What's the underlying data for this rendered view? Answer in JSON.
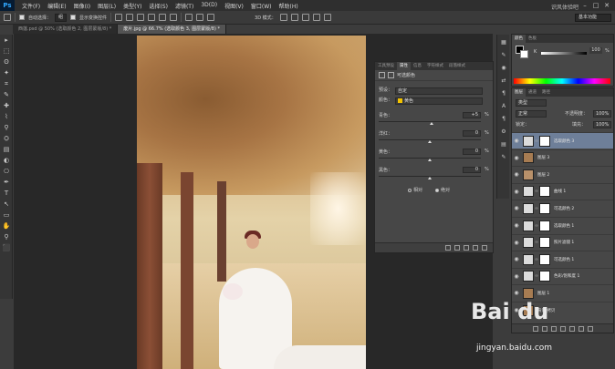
{
  "app": {
    "logo": "Ps",
    "title": "识风体验吧"
  },
  "menu": [
    "文件(F)",
    "编辑(E)",
    "图像(I)",
    "图层(L)",
    "类型(Y)",
    "选择(S)",
    "滤镜(T)",
    "3D(D)",
    "视图(V)",
    "窗口(W)",
    "帮助(H)"
  ],
  "options": {
    "auto_select_label": "自动选择：",
    "auto_select_value": "组",
    "show_transform_label": "显示变换控件",
    "mode_label": "3D 模式：",
    "workspace": "基本功能"
  },
  "tabs": [
    {
      "label": "西莲.psd @ 50% (选取颜色 2, 图层蒙版/8) *",
      "active": false
    },
    {
      "label": "废片.jpg @ 66.7% (选取颜色 3, 图层蒙版/8) *",
      "active": true
    }
  ],
  "tools": [
    "▸",
    "⬚",
    "ʘ",
    "✦",
    "⌗",
    "✎",
    "✚",
    "⌇",
    "⚲",
    "⛭",
    "▤",
    "◐",
    "⎔",
    "✒",
    "T",
    "↖",
    "▭",
    "✋",
    "⚲",
    "⬛"
  ],
  "properties": {
    "tabs": [
      "工具预设",
      "属性",
      "信息",
      "字符样式",
      "段落样式"
    ],
    "active_tab": 1,
    "title": "可选颜色",
    "preset_label": "预设：",
    "preset_value": "自定",
    "colors_label": "颜色：",
    "colors_value": "黄色",
    "sliders": [
      {
        "label": "青色：",
        "value": "+5",
        "pct": "%",
        "knob": 0.52
      },
      {
        "label": "洋红：",
        "value": "0",
        "pct": "%",
        "knob": 0.5
      },
      {
        "label": "黄色：",
        "value": "0",
        "pct": "%",
        "knob": 0.5
      },
      {
        "label": "黑色：",
        "value": "0",
        "pct": "%",
        "knob": 0.5
      }
    ],
    "relative_label": "相对",
    "absolute_label": "绝对",
    "absolute_selected": true
  },
  "dock_icons": [
    "▦",
    "✎",
    "◉",
    "⇄",
    "¶",
    "A",
    "¶",
    "⚙",
    "▤",
    "✎"
  ],
  "color_panel": {
    "tabs": [
      "颜色",
      "色板"
    ],
    "active_tab": 0,
    "k_label": "K",
    "k_value": "100",
    "k_pct": "%"
  },
  "layers_panel": {
    "tabs": [
      "图层",
      "通道",
      "路径"
    ],
    "active_tab": 0,
    "kind_label": "类型",
    "blend_mode": "正常",
    "opacity_label": "不透明度：",
    "opacity": "100%",
    "lock_label": "锁定：",
    "fill_label": "填充：",
    "fill": "100%",
    "layers": [
      {
        "name": "选取颜色 3",
        "thumb": "adj",
        "mask": true,
        "selected": true
      },
      {
        "name": "图层 3",
        "thumb": "photo",
        "mask": false,
        "selected": false
      },
      {
        "name": "图层 2",
        "thumb": "photo2",
        "mask": false,
        "selected": false
      },
      {
        "name": "曲线 1",
        "thumb": "adj",
        "mask": true,
        "selected": false
      },
      {
        "name": "可选颜色 2",
        "thumb": "adj",
        "mask": true,
        "selected": false
      },
      {
        "name": "选取颜色 1",
        "thumb": "adj",
        "mask": true,
        "selected": false
      },
      {
        "name": "照片滤镜 1",
        "thumb": "adj",
        "mask": true,
        "selected": false
      },
      {
        "name": "可选颜色 1",
        "thumb": "adj",
        "mask": true,
        "selected": false
      },
      {
        "name": "色彩/饱和度 1",
        "thumb": "adj",
        "mask": true,
        "selected": false
      },
      {
        "name": "图层 1",
        "thumb": "photo",
        "mask": false,
        "selected": false
      },
      {
        "name": "背景 拷贝",
        "thumb": "photo",
        "mask": false,
        "selected": false
      }
    ]
  },
  "watermark": {
    "logo": "Bai du",
    "url": "jingyan.baidu.com"
  }
}
